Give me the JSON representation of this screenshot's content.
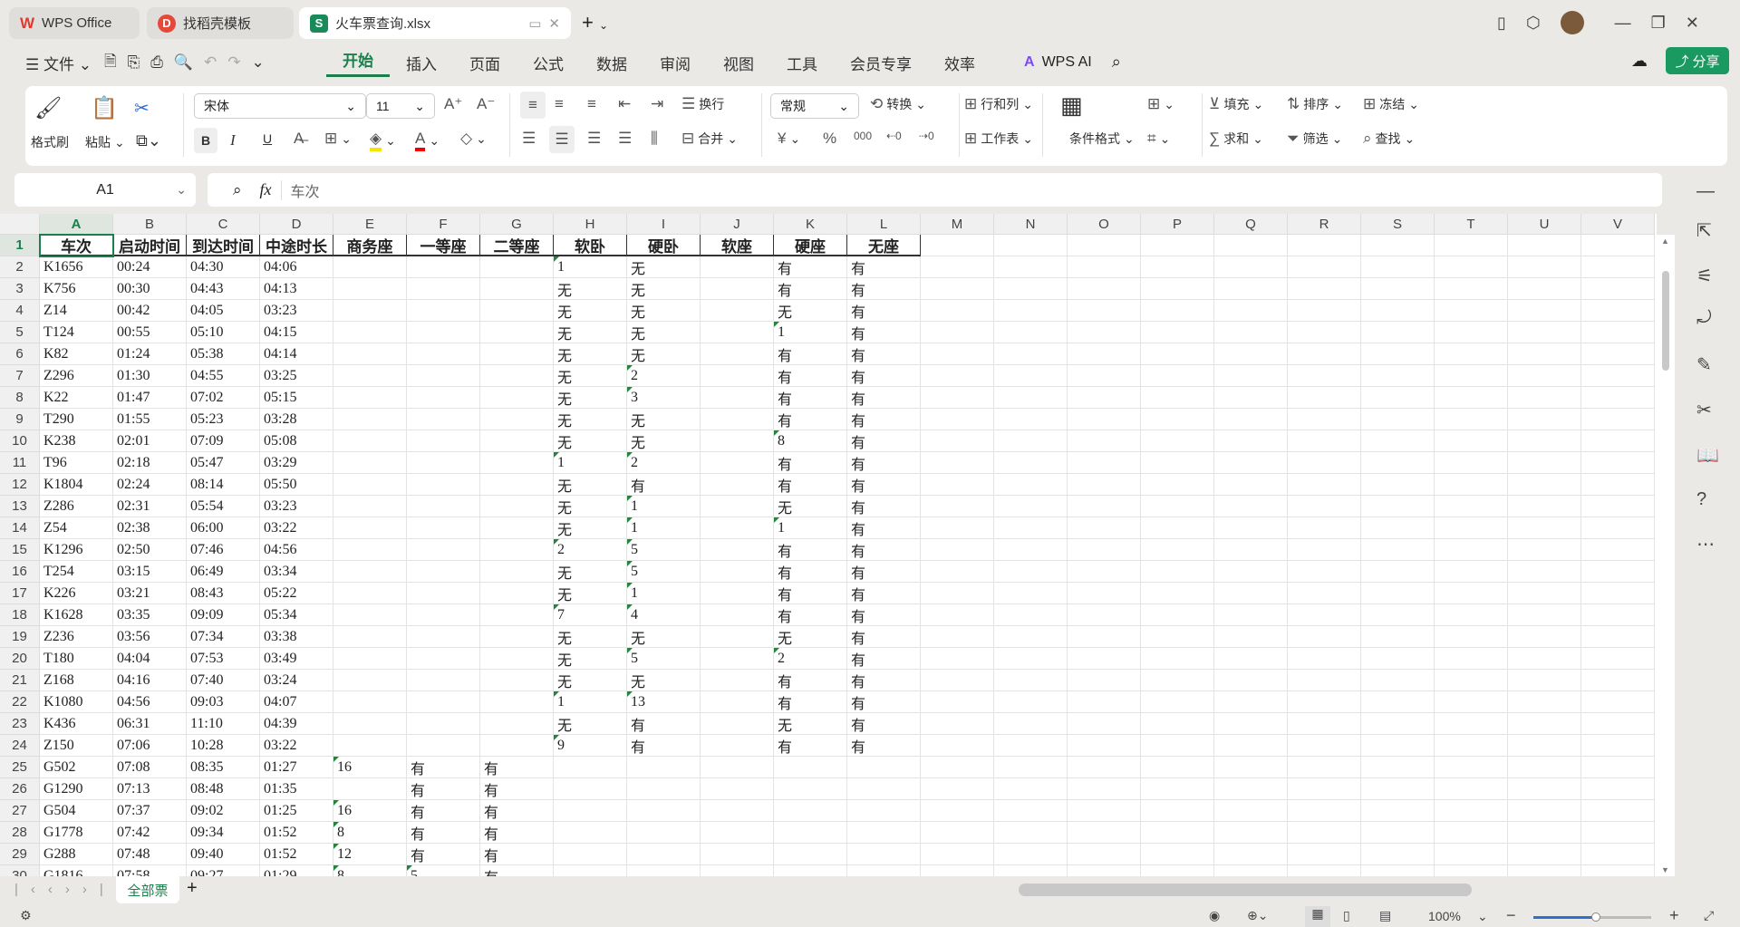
{
  "tabs": [
    {
      "label": "WPS Office",
      "icon": "wps-logo-icon"
    },
    {
      "label": "找稻壳模板",
      "icon": "docer-icon"
    },
    {
      "label": "火车票查询.xlsx",
      "icon": "spreadsheet-icon",
      "active": true
    }
  ],
  "menu": {
    "file": "文件",
    "items": [
      "开始",
      "插入",
      "页面",
      "公式",
      "数据",
      "审阅",
      "视图",
      "工具",
      "会员专享",
      "效率"
    ],
    "active": "开始",
    "ai": "WPS AI",
    "share": "分享"
  },
  "ribbon": {
    "format_painter": "格式刷",
    "paste": "粘贴",
    "font": "宋体",
    "font_size": "11",
    "wrap": "换行",
    "merge": "合并",
    "number_format": "常规",
    "convert": "转换",
    "rows_cols": "行和列",
    "worksheet": "工作表",
    "cond_format": "条件格式",
    "fill": "填充",
    "sort": "排序",
    "freeze": "冻结",
    "sum": "求和",
    "filter": "筛选",
    "find": "查找",
    "bold": "B",
    "italic": "I",
    "underline": "U"
  },
  "formula_bar": {
    "cell_ref": "A1",
    "fx": "fx",
    "content": "车次"
  },
  "columns": [
    "A",
    "B",
    "C",
    "D",
    "E",
    "F",
    "G",
    "H",
    "I",
    "J",
    "K",
    "L",
    "M",
    "N",
    "O",
    "P",
    "Q",
    "R",
    "S",
    "T",
    "U",
    "V"
  ],
  "headers": [
    "车次",
    "启动时间",
    "到达时间",
    "中途时长",
    "商务座",
    "一等座",
    "二等座",
    "软卧",
    "硬卧",
    "软座",
    "硬座",
    "无座"
  ],
  "rows": [
    [
      "K1656",
      "00:24",
      "04:30",
      "04:06",
      "",
      "",
      "",
      "1",
      "无",
      "",
      "有",
      "有"
    ],
    [
      "K756",
      "00:30",
      "04:43",
      "04:13",
      "",
      "",
      "",
      "无",
      "无",
      "",
      "有",
      "有"
    ],
    [
      "Z14",
      "00:42",
      "04:05",
      "03:23",
      "",
      "",
      "",
      "无",
      "无",
      "",
      "无",
      "有"
    ],
    [
      "T124",
      "00:55",
      "05:10",
      "04:15",
      "",
      "",
      "",
      "无",
      "无",
      "",
      "1",
      "有"
    ],
    [
      "K82",
      "01:24",
      "05:38",
      "04:14",
      "",
      "",
      "",
      "无",
      "无",
      "",
      "有",
      "有"
    ],
    [
      "Z296",
      "01:30",
      "04:55",
      "03:25",
      "",
      "",
      "",
      "无",
      "2",
      "",
      "有",
      "有"
    ],
    [
      "K22",
      "01:47",
      "07:02",
      "05:15",
      "",
      "",
      "",
      "无",
      "3",
      "",
      "有",
      "有"
    ],
    [
      "T290",
      "01:55",
      "05:23",
      "03:28",
      "",
      "",
      "",
      "无",
      "无",
      "",
      "有",
      "有"
    ],
    [
      "K238",
      "02:01",
      "07:09",
      "05:08",
      "",
      "",
      "",
      "无",
      "无",
      "",
      "8",
      "有"
    ],
    [
      "T96",
      "02:18",
      "05:47",
      "03:29",
      "",
      "",
      "",
      "1",
      "2",
      "",
      "有",
      "有"
    ],
    [
      "K1804",
      "02:24",
      "08:14",
      "05:50",
      "",
      "",
      "",
      "无",
      "有",
      "",
      "有",
      "有"
    ],
    [
      "Z286",
      "02:31",
      "05:54",
      "03:23",
      "",
      "",
      "",
      "无",
      "1",
      "",
      "无",
      "有"
    ],
    [
      "Z54",
      "02:38",
      "06:00",
      "03:22",
      "",
      "",
      "",
      "无",
      "1",
      "",
      "1",
      "有"
    ],
    [
      "K1296",
      "02:50",
      "07:46",
      "04:56",
      "",
      "",
      "",
      "2",
      "5",
      "",
      "有",
      "有"
    ],
    [
      "T254",
      "03:15",
      "06:49",
      "03:34",
      "",
      "",
      "",
      "无",
      "5",
      "",
      "有",
      "有"
    ],
    [
      "K226",
      "03:21",
      "08:43",
      "05:22",
      "",
      "",
      "",
      "无",
      "1",
      "",
      "有",
      "有"
    ],
    [
      "K1628",
      "03:35",
      "09:09",
      "05:34",
      "",
      "",
      "",
      "7",
      "4",
      "",
      "有",
      "有"
    ],
    [
      "Z236",
      "03:56",
      "07:34",
      "03:38",
      "",
      "",
      "",
      "无",
      "无",
      "",
      "无",
      "有"
    ],
    [
      "T180",
      "04:04",
      "07:53",
      "03:49",
      "",
      "",
      "",
      "无",
      "5",
      "",
      "2",
      "有"
    ],
    [
      "Z168",
      "04:16",
      "07:40",
      "03:24",
      "",
      "",
      "",
      "无",
      "无",
      "",
      "有",
      "有"
    ],
    [
      "K1080",
      "04:56",
      "09:03",
      "04:07",
      "",
      "",
      "",
      "1",
      "13",
      "",
      "有",
      "有"
    ],
    [
      "K436",
      "06:31",
      "11:10",
      "04:39",
      "",
      "",
      "",
      "无",
      "有",
      "",
      "无",
      "有"
    ],
    [
      "Z150",
      "07:06",
      "10:28",
      "03:22",
      "",
      "",
      "",
      "9",
      "有",
      "",
      "有",
      "有"
    ],
    [
      "G502",
      "07:08",
      "08:35",
      "01:27",
      "16",
      "有",
      "有",
      "",
      "",
      "",
      "",
      ""
    ],
    [
      "G1290",
      "07:13",
      "08:48",
      "01:35",
      "",
      "有",
      "有",
      "",
      "",
      "",
      "",
      ""
    ],
    [
      "G504",
      "07:37",
      "09:02",
      "01:25",
      "16",
      "有",
      "有",
      "",
      "",
      "",
      "",
      ""
    ],
    [
      "G1778",
      "07:42",
      "09:34",
      "01:52",
      "8",
      "有",
      "有",
      "",
      "",
      "",
      "",
      ""
    ],
    [
      "G288",
      "07:48",
      "09:40",
      "01:52",
      "12",
      "有",
      "有",
      "",
      "",
      "",
      "",
      ""
    ],
    [
      "G1816",
      "07:58",
      "09:27",
      "01:29",
      "8",
      "5",
      "有",
      "",
      "",
      "",
      "",
      ""
    ]
  ],
  "sheets": [
    "全部票"
  ],
  "status": {
    "zoom": "100%"
  },
  "colors": {
    "accent": "#1a7f4b",
    "selection": "#1a7f4b",
    "number_text_flag": "#1a8a3a"
  }
}
